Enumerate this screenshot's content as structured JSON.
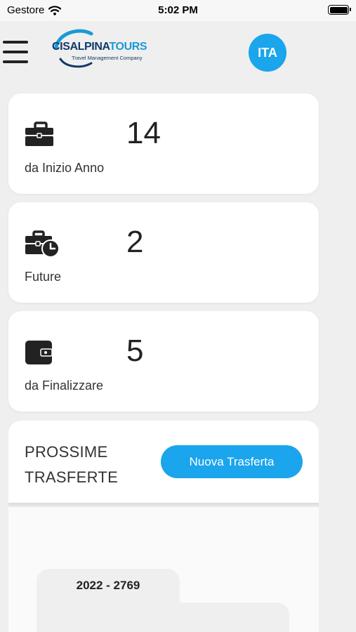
{
  "status_bar": {
    "carrier": "Gestore",
    "time": "5:02 PM",
    "wifi_icon": "wifi-icon",
    "battery_icon": "battery-icon"
  },
  "header": {
    "menu_icon": "hamburger-icon",
    "logo": {
      "name_part1": "CISALPINA",
      "name_part2": "TOURS",
      "tagline": "Travel Management Company"
    },
    "language": "ITA"
  },
  "stats": [
    {
      "icon": "briefcase-icon",
      "value": "14",
      "label": "da Inizio Anno"
    },
    {
      "icon": "briefcase-clock-icon",
      "value": "2",
      "label": "Future"
    },
    {
      "icon": "wallet-icon",
      "value": "5",
      "label": "da Finalizzare"
    }
  ],
  "trips": {
    "title_line1": "PROSSIME",
    "title_line2": "TRASFERTE",
    "new_trip_label": "Nuova Trasferta",
    "items": [
      {
        "code": "2022 - 2769",
        "from_partial": "…",
        "to_partial": "…"
      }
    ]
  },
  "colors": {
    "accent": "#1aa5ec",
    "background": "#efefef",
    "card": "#ffffff",
    "logo_dark": "#123a6b",
    "logo_light": "#1a9ad6"
  }
}
